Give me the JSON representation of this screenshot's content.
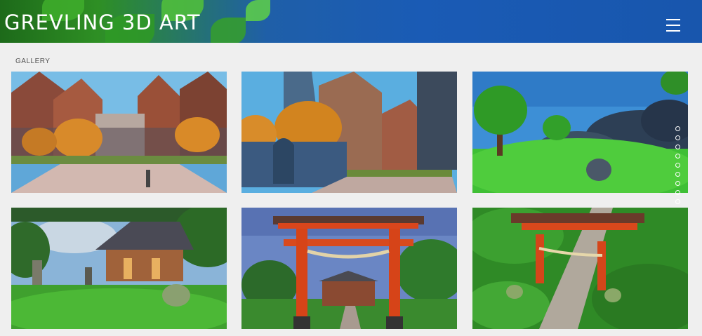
{
  "header": {
    "site_title": "GREVLING 3D ART",
    "menu_icon": "hamburger-menu-icon",
    "brand_color": "#1a5bb5"
  },
  "gallery": {
    "section_label": "GALLERY",
    "images": [
      {
        "name": "medieval-town-square"
      },
      {
        "name": "medieval-town-street"
      },
      {
        "name": "green-hills-with-trees"
      },
      {
        "name": "japanese-temple-with-lanterns"
      },
      {
        "name": "red-torii-gate-front"
      },
      {
        "name": "red-torii-gate-aerial"
      }
    ]
  },
  "pagination": {
    "dot_count": 9,
    "active_index": 0
  }
}
